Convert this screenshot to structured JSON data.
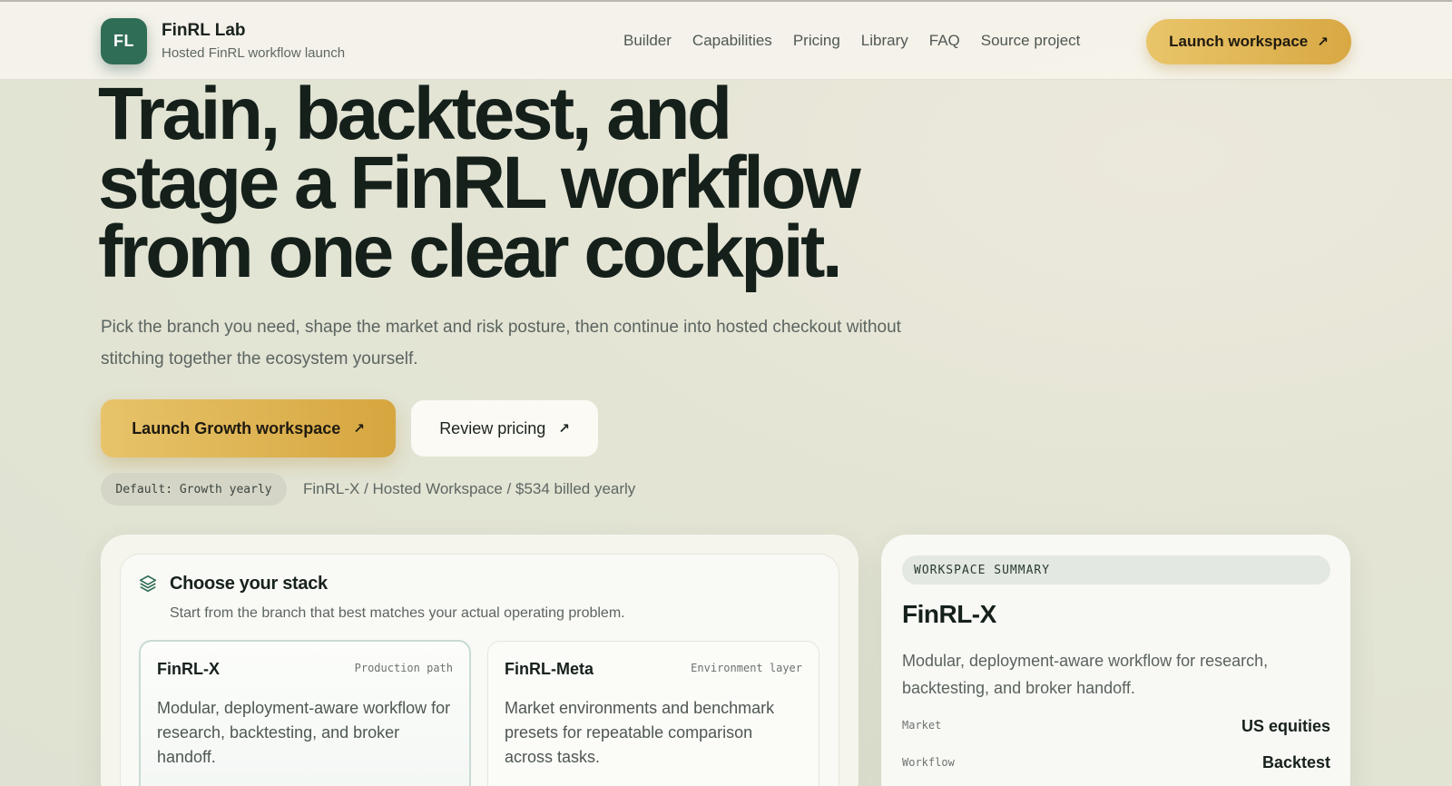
{
  "header": {
    "logo_text": "FL",
    "brand_name": "FinRL Lab",
    "brand_subtitle": "Hosted FinRL workflow launch",
    "nav": [
      "Builder",
      "Capabilities",
      "Pricing",
      "Library",
      "FAQ",
      "Source project"
    ],
    "cta_label": "Launch workspace",
    "cta_icon": "arrow-up-right-icon"
  },
  "hero": {
    "headline_line1": "Train, backtest, and",
    "headline_line2": "stage a FinRL workflow",
    "headline_line3": "from one clear cockpit.",
    "subtext": "Pick the branch you need, shape the market and risk posture, then continue into hosted checkout without stitching together the ecosystem yourself.",
    "primary_button": "Launch Growth workspace",
    "secondary_button": "Review pricing",
    "default_pill": "Default: Growth yearly",
    "default_description": "FinRL-X / Hosted Workspace / $534 billed yearly"
  },
  "stack": {
    "title": "Choose your stack",
    "subtitle": "Start from the branch that best matches your actual operating problem.",
    "options": [
      {
        "name": "FinRL-X",
        "tag": "Production path",
        "description": "Modular, deployment-aware workflow for research, backtesting, and broker handoff."
      },
      {
        "name": "FinRL-Meta",
        "tag": "Environment layer",
        "description": "Market environments and benchmark presets for repeatable comparison across tasks."
      }
    ]
  },
  "summary": {
    "label": "WORKSPACE SUMMARY",
    "name": "FinRL-X",
    "description": "Modular, deployment-aware workflow for research, backtesting, and broker handoff.",
    "rows": [
      {
        "key": "Market",
        "value": "US equities"
      },
      {
        "key": "Workflow",
        "value": "Backtest"
      }
    ]
  },
  "colors": {
    "brand_green": "#2f6d57",
    "accent_gold": "#e2b957",
    "text_dark": "#15201b",
    "background": "#e3e4d4"
  }
}
